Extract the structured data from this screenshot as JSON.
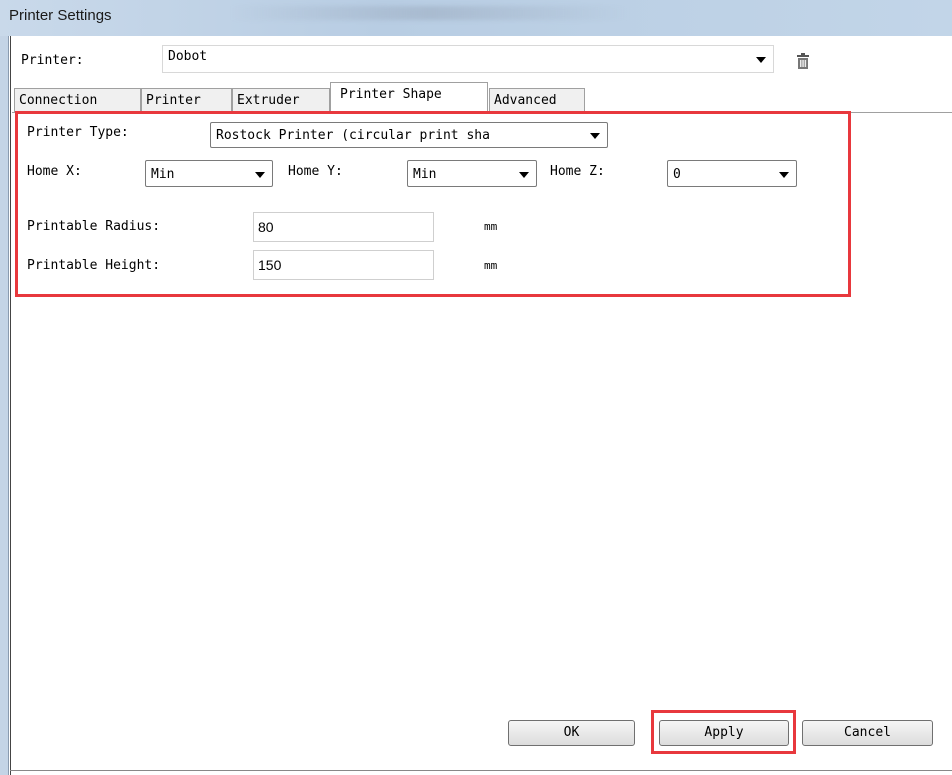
{
  "window": {
    "title": "Printer Settings"
  },
  "printer": {
    "label": "Printer:",
    "selected": "Dobot",
    "delete_icon": "trash-icon"
  },
  "tabs": [
    {
      "label": "Connection",
      "active": false
    },
    {
      "label": "Printer",
      "active": false
    },
    {
      "label": "Extruder",
      "active": false
    },
    {
      "label": "Printer Shape",
      "active": true
    },
    {
      "label": "Advanced",
      "active": false
    }
  ],
  "shape": {
    "printer_type_label": "Printer Type:",
    "printer_type_value": "Rostock Printer (circular print sha",
    "home_x_label": "Home X:",
    "home_x_value": "Min",
    "home_y_label": "Home Y:",
    "home_y_value": "Min",
    "home_z_label": "Home Z:",
    "home_z_value": "0",
    "radius_label": "Printable Radius:",
    "radius_value": "80",
    "radius_unit": "mm",
    "height_label": "Printable Height:",
    "height_value": "150",
    "height_unit": "mm"
  },
  "buttons": {
    "ok": "OK",
    "apply": "Apply",
    "cancel": "Cancel"
  },
  "colors": {
    "highlight": "#e8383d",
    "titlebar": "#c2d5e8"
  }
}
